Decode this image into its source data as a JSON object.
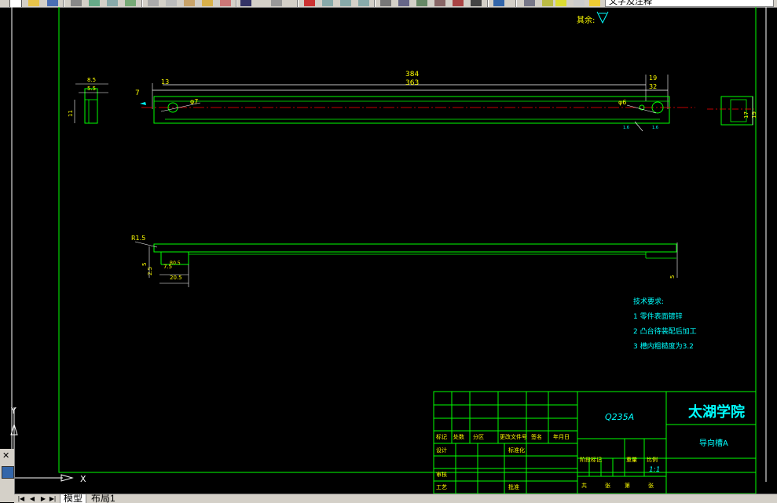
{
  "toolbar": {
    "layer_combo_value": "文字及注释",
    "buttons": [
      "new-icon",
      "open-icon",
      "save-icon",
      "print-icon",
      "preview-icon",
      "publish-icon",
      "plot-icon",
      "cut-icon",
      "copy-icon",
      "paste-icon",
      "matchprop-icon",
      "blockeditor-icon",
      "undo-icon",
      "redo-icon",
      "pan-icon",
      "zoom-realtime-icon",
      "zoom-window-icon",
      "zoom-previous-icon",
      "properties-icon",
      "designcenter-icon",
      "toolpalette-icon",
      "sheetset-icon",
      "markup-icon",
      "calculator-icon",
      "help-icon",
      "layer-manager-icon",
      "layer-state-icon"
    ]
  },
  "tabs": {
    "model": "模型",
    "layout": "布局1"
  },
  "drawing": {
    "surface_roughness": "其余:",
    "top_view": {
      "overall": "384",
      "inner": "363",
      "left_offset": "13",
      "right_a": "19",
      "right_b": "32",
      "hole_left": "φ7",
      "hole_right": "φ6",
      "left_margin": "7",
      "roughness": "1.6"
    },
    "left_view": {
      "a": "8.5",
      "b": "5.5",
      "c": "11"
    },
    "right_view": {
      "a": "17",
      "b": "19"
    },
    "front_view": {
      "radius": "R1.5",
      "a": "5",
      "b": "2.5",
      "c": "7.5",
      "d": "20.5",
      "e": "5",
      "f": "R0.5"
    },
    "tech_requirements": {
      "title": "技术要求:",
      "items": [
        "1  零件表面镀锌",
        "2  凸台待装配后加工",
        "3  槽内粗糙度为3.2"
      ]
    },
    "title_block": {
      "material": "Q235A",
      "school": "太湖学院",
      "part_name": "导向槽A",
      "scale": "1:1",
      "labels": {
        "mark": "标记",
        "count": "处数",
        "zone": "分区",
        "change_doc": "更改文件号",
        "sign": "签名",
        "date": "年月日",
        "design": "设计",
        "std": "标准化",
        "stage_mark": "阶段标记",
        "weight": "重量",
        "scale_lbl": "比例",
        "review": "审核",
        "process": "工艺",
        "approve": "批准",
        "sheets": "共",
        "sheet": "张",
        "of": "第",
        "sheet2": "张"
      }
    }
  },
  "ucs": {
    "x": "X",
    "y": "Y"
  }
}
